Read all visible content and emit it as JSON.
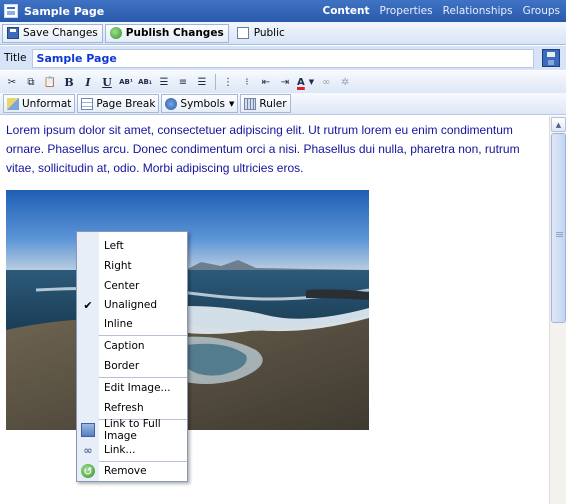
{
  "window": {
    "title": "Sample Page",
    "nav": [
      "Content",
      "Properties",
      "Relationships",
      "Groups"
    ],
    "active_nav": "Content"
  },
  "actions": {
    "save": "Save Changes",
    "publish": "Publish Changes",
    "public": "Public"
  },
  "title_field": {
    "label": "Title",
    "value": "Sample Page"
  },
  "toolbar": {
    "bold": "B",
    "italic": "I",
    "underline": "U",
    "superscript": "AB¹",
    "subscript": "AB₁",
    "font_color": "A",
    "unformat": "Unformat",
    "page_break": "Page Break",
    "symbols": "Symbols",
    "ruler": "Ruler"
  },
  "editor": {
    "text": "Lorem ipsum dolor sit amet, consectetuer adipiscing elit. Ut rutrum lorem eu enim condimentum ornare. Phasellus arcu. Donec condimentum orci a nisi. Phasellus dui nulla, pharetra non, rutrum vitae, sollicitudin at, odio. Morbi adipiscing ultricies eros."
  },
  "context_menu": {
    "items": [
      {
        "label": "Left"
      },
      {
        "label": "Right"
      },
      {
        "label": "Center"
      },
      {
        "label": "Unaligned",
        "checked": true
      },
      {
        "label": "Inline"
      },
      {
        "label": "Caption"
      },
      {
        "label": "Border"
      },
      {
        "label": "Edit Image..."
      },
      {
        "label": "Refresh"
      },
      {
        "label": "Link to Full Image"
      },
      {
        "label": "Link..."
      },
      {
        "label": "Remove"
      }
    ]
  },
  "colors": {
    "titlebar": "#2f5fb3",
    "title_text": "#0d37d4",
    "body_text": "#14149e",
    "toolbar_bg": "#dde7f6"
  }
}
